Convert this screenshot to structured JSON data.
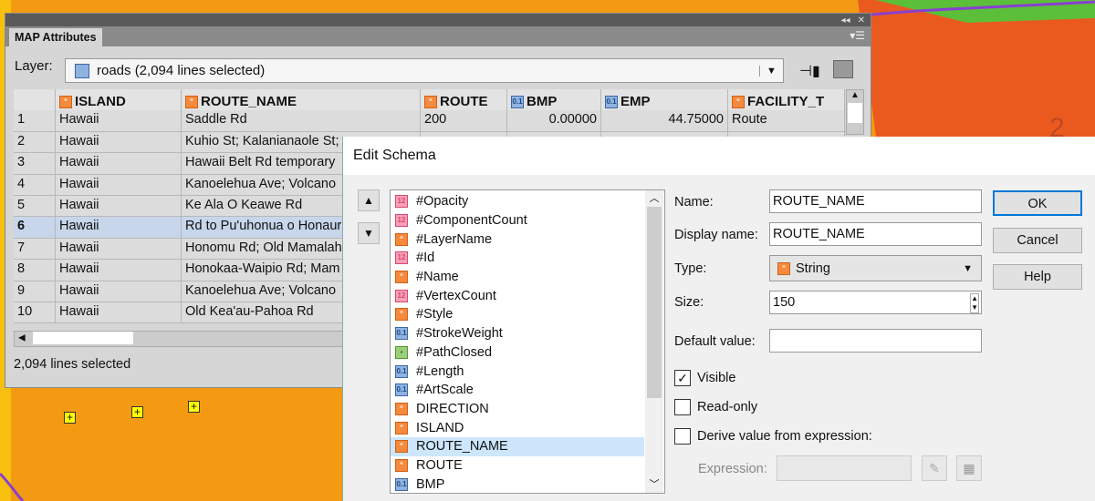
{
  "colors": {
    "map_yellow": "#f7c00e",
    "map_orange": "#f39a12",
    "map_red": "#ea5a1e",
    "accent_select": "#cde6fb"
  },
  "panel": {
    "title": "MAP Attributes",
    "layer_label": "Layer:",
    "layer_value": "roads (2,094 lines selected)",
    "status": "2,094 lines selected",
    "columns": [
      {
        "name": "ISLAND",
        "type": "string"
      },
      {
        "name": "ROUTE_NAME",
        "type": "string"
      },
      {
        "name": "ROUTE",
        "type": "string"
      },
      {
        "name": "BMP",
        "type": "float"
      },
      {
        "name": "EMP",
        "type": "float"
      },
      {
        "name": "FACILITY_T",
        "type": "string"
      }
    ],
    "rows": [
      {
        "n": "1",
        "island": "Hawaii",
        "route_name": "Saddle Rd",
        "route": "200",
        "bmp": "0.00000",
        "emp": "44.75000",
        "facility": "Route"
      },
      {
        "n": "2",
        "island": "Hawaii",
        "route_name": "Kuhio St; Kalanianaole St;"
      },
      {
        "n": "3",
        "island": "Hawaii",
        "route_name": "Hawaii Belt Rd temporary"
      },
      {
        "n": "4",
        "island": "Hawaii",
        "route_name": "Kanoelehua Ave; Volcano"
      },
      {
        "n": "5",
        "island": "Hawaii",
        "route_name": "Ke Ala O Keawe Rd"
      },
      {
        "n": "6",
        "island": "Hawaii",
        "route_name": "Rd to Pu'uhonua o Honaur"
      },
      {
        "n": "7",
        "island": "Hawaii",
        "route_name": "Honomu Rd; Old Mamalah"
      },
      {
        "n": "8",
        "island": "Hawaii",
        "route_name": "Honokaa-Waipio Rd; Mam"
      },
      {
        "n": "9",
        "island": "Hawaii",
        "route_name": "Kanoelehua Ave; Volcano"
      },
      {
        "n": "10",
        "island": "Hawaii",
        "route_name": "Old Kea'au-Pahoa Rd"
      }
    ]
  },
  "dialog": {
    "title": "Edit Schema",
    "fields": [
      {
        "name": "#Opacity",
        "type": "n"
      },
      {
        "name": "#ComponentCount",
        "type": "n"
      },
      {
        "name": "#LayerName",
        "type": "s"
      },
      {
        "name": "#Id",
        "type": "n"
      },
      {
        "name": "#Name",
        "type": "s"
      },
      {
        "name": "#VertexCount",
        "type": "n"
      },
      {
        "name": "#Style",
        "type": "s"
      },
      {
        "name": "#StrokeWeight",
        "type": "f"
      },
      {
        "name": "#PathClosed",
        "type": "b"
      },
      {
        "name": "#Length",
        "type": "f"
      },
      {
        "name": "#ArtScale",
        "type": "f"
      },
      {
        "name": "DIRECTION",
        "type": "s"
      },
      {
        "name": "ISLAND",
        "type": "s"
      },
      {
        "name": "ROUTE_NAME",
        "type": "s"
      },
      {
        "name": "ROUTE",
        "type": "s"
      },
      {
        "name": "BMP",
        "type": "f"
      }
    ],
    "selected_field": "ROUTE_NAME",
    "name_label": "Name:",
    "name_value": "ROUTE_NAME",
    "display_label": "Display name:",
    "display_value": "ROUTE_NAME",
    "type_label": "Type:",
    "type_value": "String",
    "size_label": "Size:",
    "size_value": "150",
    "default_label": "Default value:",
    "default_value": "",
    "visible_label": "Visible",
    "visible": true,
    "readonly_label": "Read-only",
    "readonly": false,
    "derive_label": "Derive value from expression:",
    "derive": false,
    "expression_label": "Expression:",
    "ok": "OK",
    "cancel": "Cancel",
    "help": "Help"
  }
}
